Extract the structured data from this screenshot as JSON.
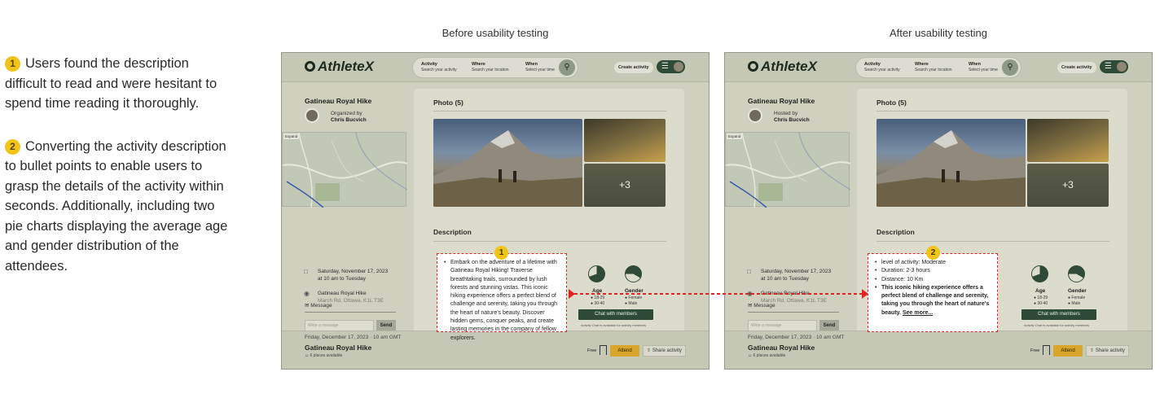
{
  "notes": [
    {
      "number": "1",
      "text": "Users found the description difficult to read and were hesitant to spend time reading it thoroughly."
    },
    {
      "number": "2",
      "text": "Converting the activity description to bullet points to enable users to grasp the details of the activity within seconds. Additionally, including two pie charts displaying the average age and gender distribution of the attendees."
    }
  ],
  "captions": {
    "before": "Before usability testing",
    "after": "After usability testing"
  },
  "app": {
    "logo": "AthleteX",
    "search": {
      "activity_label": "Activity",
      "activity_placeholder": "Search your activity",
      "where_label": "Where",
      "where_placeholder": "Search your location",
      "when_label": "When",
      "when_placeholder": "Select your time"
    },
    "create_label": "Create activity",
    "activity_title": "Gatineau Royal Hike",
    "organizer_name": "Chris Bucvich",
    "map_expand": "Expand",
    "date_line1": "Saturday, November 17, 2023",
    "date_line2": "at 10 am to Tuesday",
    "location_line1": "Gatineau Royal Hike",
    "location_line2": "March Rd. Ottawa, K1L T3E",
    "message_label": "Message",
    "message_placeholder": "Write a message",
    "send_label": "Send",
    "photo_title": "Photo (5)",
    "photo_more": "+3",
    "description_title": "Description",
    "age_label": "Age",
    "gender_label": "Gender",
    "age_legend": [
      "18-29",
      "30-40"
    ],
    "gender_legend": [
      "Female",
      "Male"
    ],
    "chat_label": "Chat with members",
    "chat_note": "Activity Chat is available for activity members",
    "event_date": "Friday, December 17, 2023  ·  10 am GMT",
    "event_title": "Gatineau Royal Hike",
    "event_places": "6 places available",
    "free_label": "Free",
    "attend_label": "Attend",
    "share_label": "Share activity"
  },
  "before": {
    "organizer_label": "Organized by",
    "description_text": "Embark on the adventure of a lifetime with Gatineau Royal Hiking! Traverse breathtaking trails, surrounded by lush forests and stunning vistas. This iconic hiking experience offers a perfect blend of challenge and serenity, taking you through the heart of nature's beauty. Discover hidden gems, conquer peaks, and create lasting memories in the company of fellow explorers.",
    "callout_number": "1"
  },
  "after": {
    "organizer_label": "Hosted by",
    "bullets": [
      "level of activity: Moderate",
      "Duration: 2-3 hours",
      "Distance: 10 Km"
    ],
    "bold_text": "This iconic hiking experience offers a perfect blend of challenge and serenity, taking you through the heart of nature's beauty.",
    "see_more": "See more...",
    "callout_number": "2"
  }
}
